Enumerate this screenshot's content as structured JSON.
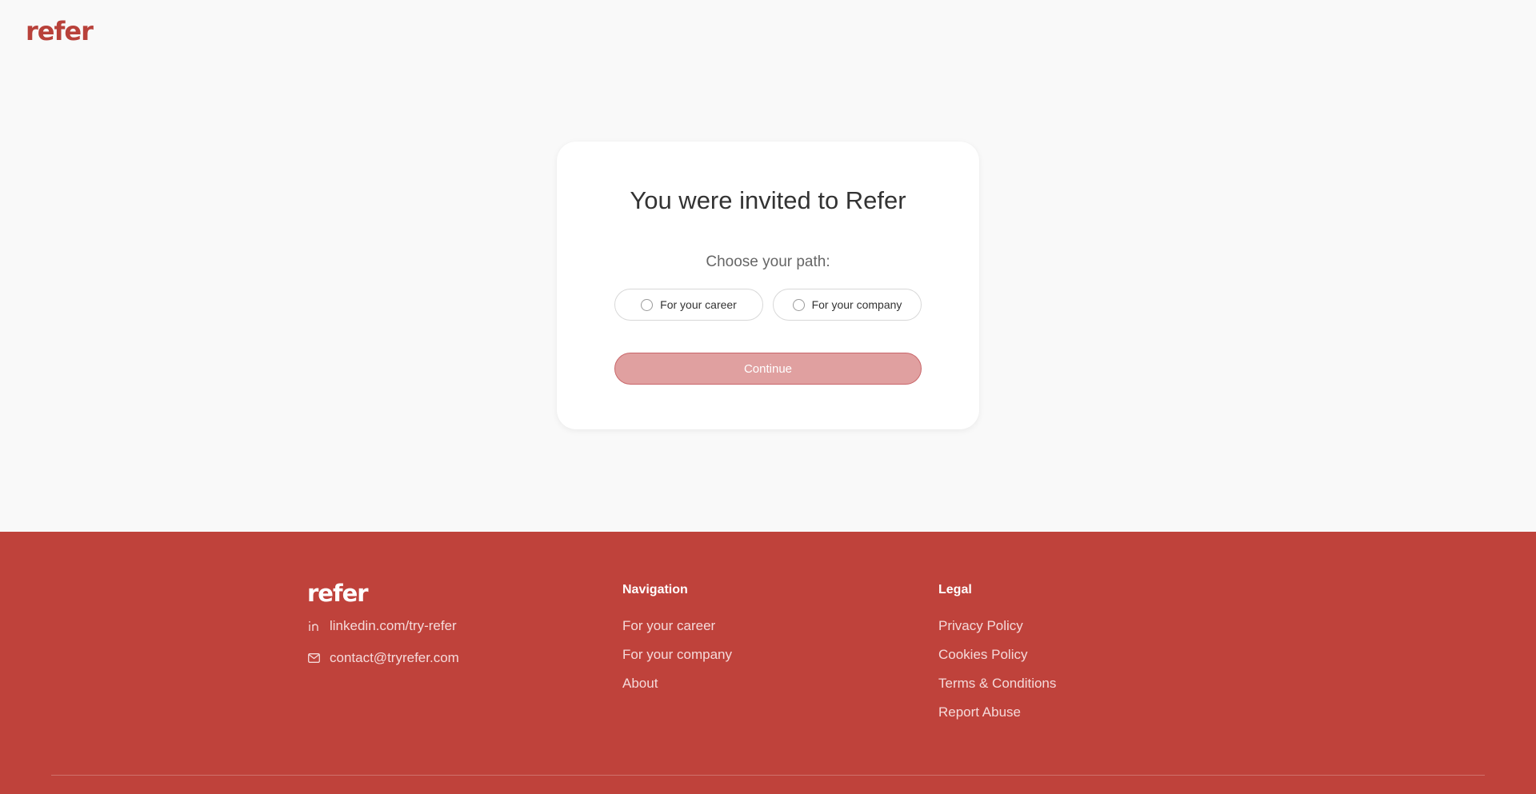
{
  "brand": {
    "name": "refer"
  },
  "card": {
    "title": "You were invited to Refer",
    "subtitle": "Choose your path:",
    "options": [
      {
        "label": "For your career",
        "selected": false
      },
      {
        "label": "For your company",
        "selected": false
      }
    ],
    "continue_label": "Continue"
  },
  "footer": {
    "linkedin": "linkedin.com/try-refer",
    "email": "contact@tryrefer.com",
    "navigation": {
      "heading": "Navigation",
      "links": [
        "For your career",
        "For your company",
        "About"
      ]
    },
    "legal": {
      "heading": "Legal",
      "links": [
        "Privacy Policy",
        "Cookies Policy",
        "Terms & Conditions",
        "Report Abuse"
      ]
    }
  },
  "colors": {
    "brand": "#bf423b",
    "background": "#f9f9f9",
    "button_disabled": "#e0a0a0"
  },
  "icons": [
    "linkedin-icon",
    "mail-icon"
  ]
}
